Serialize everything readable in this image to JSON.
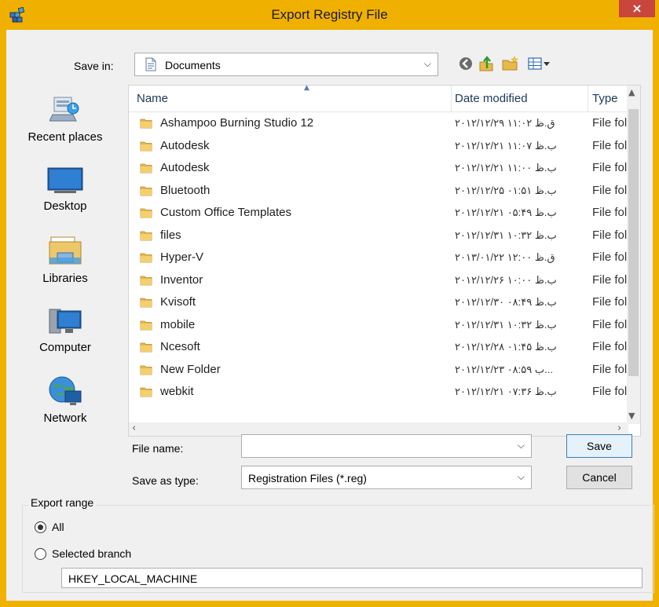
{
  "window": {
    "title": "Export Registry File",
    "close_label": "×"
  },
  "save_in": {
    "label": "Save in:",
    "value": "Documents",
    "dropdown_glyph": "⌵"
  },
  "toolbar": {
    "icons": [
      "back-icon",
      "up-folder-icon",
      "new-folder-icon",
      "view-menu-icon"
    ]
  },
  "places": [
    {
      "label": "Recent places",
      "icon": "recent-places-icon"
    },
    {
      "label": "Desktop",
      "icon": "desktop-icon"
    },
    {
      "label": "Libraries",
      "icon": "libraries-icon"
    },
    {
      "label": "Computer",
      "icon": "computer-icon"
    },
    {
      "label": "Network",
      "icon": "network-icon"
    }
  ],
  "file_list": {
    "columns": {
      "name": "Name",
      "date": "Date modified",
      "type": "Type"
    },
    "rows": [
      {
        "name": "Ashampoo Burning Studio 12",
        "date": "۲۰۱۲/۱۲/۲۹ ق.ظ ۱۱:۰۲",
        "type": "File fol"
      },
      {
        "name": "Autodesk",
        "date": "۲۰۱۲/۱۲/۲۱ ب.ظ ۱۱:۰۷",
        "type": "File fol"
      },
      {
        "name": "Autodesk",
        "date": "۲۰۱۲/۱۲/۲۱ ب.ظ ۱۱:۰۰",
        "type": "File fol"
      },
      {
        "name": "Bluetooth",
        "date": "۲۰۱۲/۱۲/۲۵ ب.ظ ۰۱:۵۱",
        "type": "File fol"
      },
      {
        "name": "Custom Office Templates",
        "date": "۲۰۱۲/۱۲/۲۱ ب.ظ ۰۵:۴۹",
        "type": "File fol"
      },
      {
        "name": "files",
        "date": "۲۰۱۲/۱۲/۳۱ ب.ظ ۱۰:۳۲",
        "type": "File fol"
      },
      {
        "name": "Hyper-V",
        "date": "۲۰۱۳/۰۱/۲۲ ق.ظ ۱۲:۰۰",
        "type": "File fol"
      },
      {
        "name": "Inventor",
        "date": "۲۰۱۲/۱۲/۲۶ ب.ظ ۱۰:۰۰",
        "type": "File fol"
      },
      {
        "name": "Kvisoft",
        "date": "۲۰۱۲/۱۲/۳۰ ب.ظ ۰۸:۴۹",
        "type": "File fol"
      },
      {
        "name": "mobile",
        "date": "۲۰۱۲/۱۲/۳۱ ب.ظ ۱۰:۳۲",
        "type": "File fol"
      },
      {
        "name": "Ncesoft",
        "date": "۲۰۱۲/۱۲/۲۸ ب.ظ ۰۱:۴۵",
        "type": "File fol"
      },
      {
        "name": "New Folder",
        "date": "۲۰۱۲/۱۲/۲۳ ب ۰۸:۵۹...",
        "type": "File fol"
      },
      {
        "name": "webkit",
        "date": "۲۰۱۲/۱۲/۲۱ ب.ظ ۰۷:۳۶",
        "type": "File fol"
      }
    ]
  },
  "file_name": {
    "label": "File name:",
    "value": ""
  },
  "save_as_type": {
    "label": "Save as type:",
    "value": "Registration Files (*.reg)"
  },
  "buttons": {
    "save": "Save",
    "cancel": "Cancel"
  },
  "export_range": {
    "title": "Export range",
    "all_label": "All",
    "selected_label": "Selected branch",
    "selected_option": "All",
    "branch_value": "HKEY_LOCAL_MACHINE"
  },
  "colors": {
    "title_bar": "#f0b000",
    "close_button": "#c9463d",
    "folder": "#e8b84a"
  }
}
